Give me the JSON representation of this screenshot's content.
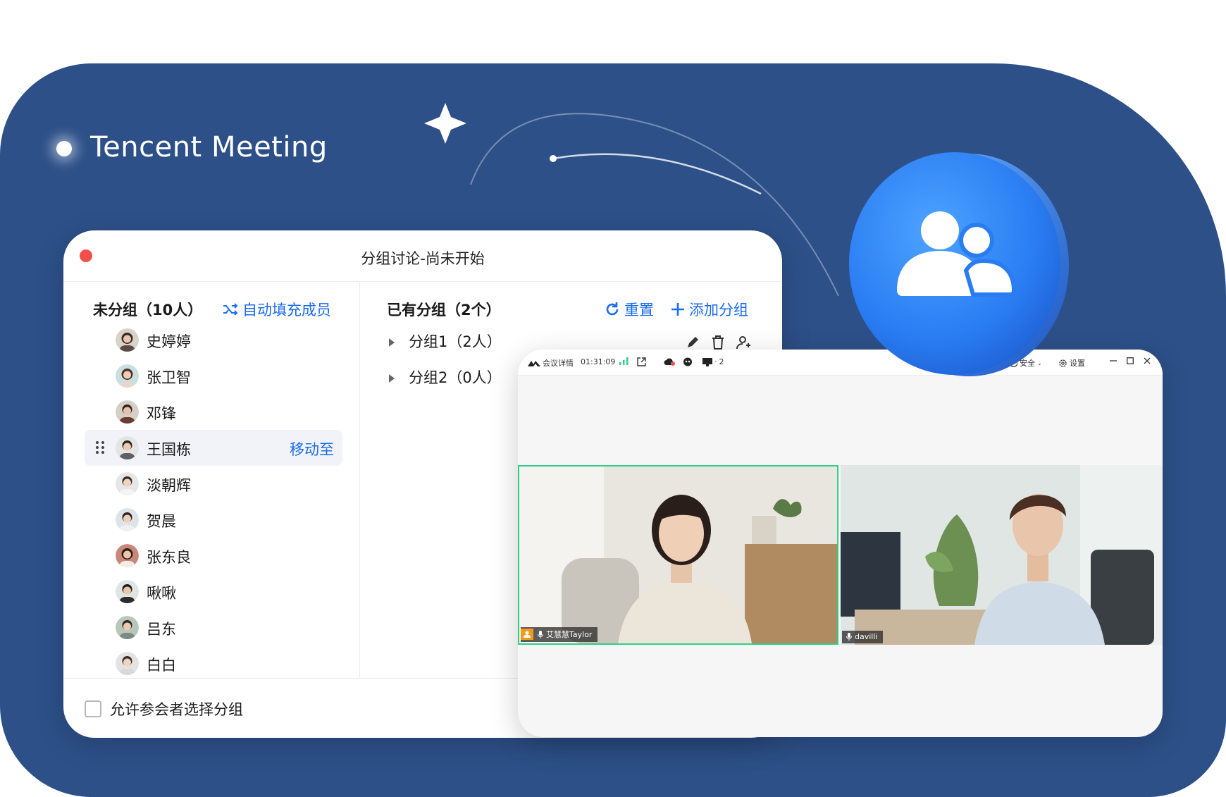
{
  "brand": {
    "name": "Tencent Meeting"
  },
  "breakout_window": {
    "title": "分组讨论-尚未开始",
    "unassigned_header": "未分组（10人）",
    "auto_fill_label": "自动填充成员",
    "members": [
      {
        "name": "史婷婷"
      },
      {
        "name": "张卫智"
      },
      {
        "name": "邓锋"
      },
      {
        "name": "王国栋",
        "action": "移动至"
      },
      {
        "name": "淡朝辉"
      },
      {
        "name": "贺晨"
      },
      {
        "name": "张东良"
      },
      {
        "name": "啾啾"
      },
      {
        "name": "吕东"
      },
      {
        "name": "白白"
      }
    ],
    "groups_header": "已有分组（2个）",
    "reset_label": "重置",
    "add_group_label": "添加分组",
    "groups": [
      {
        "label": "分组1（2人）"
      },
      {
        "label": "分组2（0人）"
      }
    ],
    "allow_choose_label": "允许参会者选择分组"
  },
  "meeting_window": {
    "details_label": "会议详情",
    "timer": "01:31:09",
    "screen_count": "2",
    "security_label": "安全",
    "settings_label": "设置",
    "participants": [
      {
        "name": "艾慧慧Taylor"
      },
      {
        "name": "davilli"
      }
    ]
  },
  "colors": {
    "background_blue": "#2d5089",
    "accent_blue": "#1a6cf0",
    "close_red": "#f2504b",
    "active_speaker_green": "#2fcf8a"
  }
}
